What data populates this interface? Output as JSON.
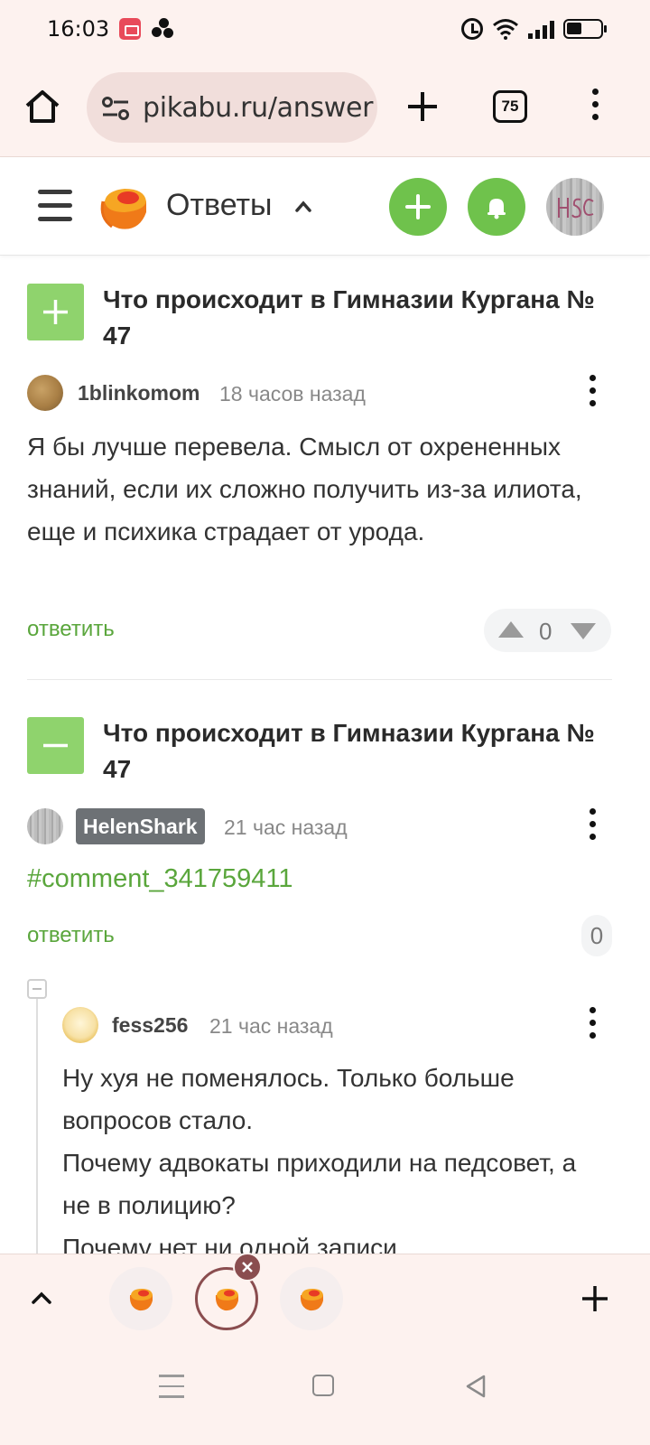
{
  "status_bar": {
    "time": "16:03"
  },
  "browser": {
    "url": "pikabu.ru/answer",
    "tab_count": "75"
  },
  "site_header": {
    "section_title": "Ответы"
  },
  "comments": [
    {
      "thread_title": "Что происходит в Гимназии Кургана № 47",
      "thread_state": "expand",
      "author": "1blinkomom",
      "time": "18 часов назад",
      "text": "Я бы лучше перевела. Смысл от охрененных знаний, если их сложно получить из-за илиота, еще и психика страдает от урода.",
      "reply_label": "ответить",
      "rating": "0"
    },
    {
      "thread_title": "Что происходит в Гимназии Кургана № 47",
      "thread_state": "collapse",
      "author": "HelenShark",
      "time": "21 час назад",
      "text": "#comment_341759411",
      "reply_label": "ответить",
      "rating": "0"
    },
    {
      "author": "fess256",
      "time": "21 час назад",
      "text_lines": [
        "Ну хуя не поменялось. Только больше вопросов стало.",
        "Почему адвокаты приходили на педсовет, а не в полицию?",
        "Почему нет ни одной записи"
      ]
    }
  ],
  "colors": {
    "accent_green": "#6fc24c",
    "link_green": "#5aa63c",
    "browser_chrome": "#fdf2ef",
    "active_tab_ring": "#8a4d4f"
  },
  "icons": [
    "home-icon",
    "site-settings-icon",
    "new-tab-plus-icon",
    "tab-switcher-icon",
    "browser-menu-icon",
    "hamburger-icon",
    "pikabu-logo",
    "chevron-up-icon",
    "plus-icon",
    "bell-icon",
    "kebab-icon",
    "arrow-up-icon",
    "arrow-down-icon",
    "close-icon"
  ]
}
